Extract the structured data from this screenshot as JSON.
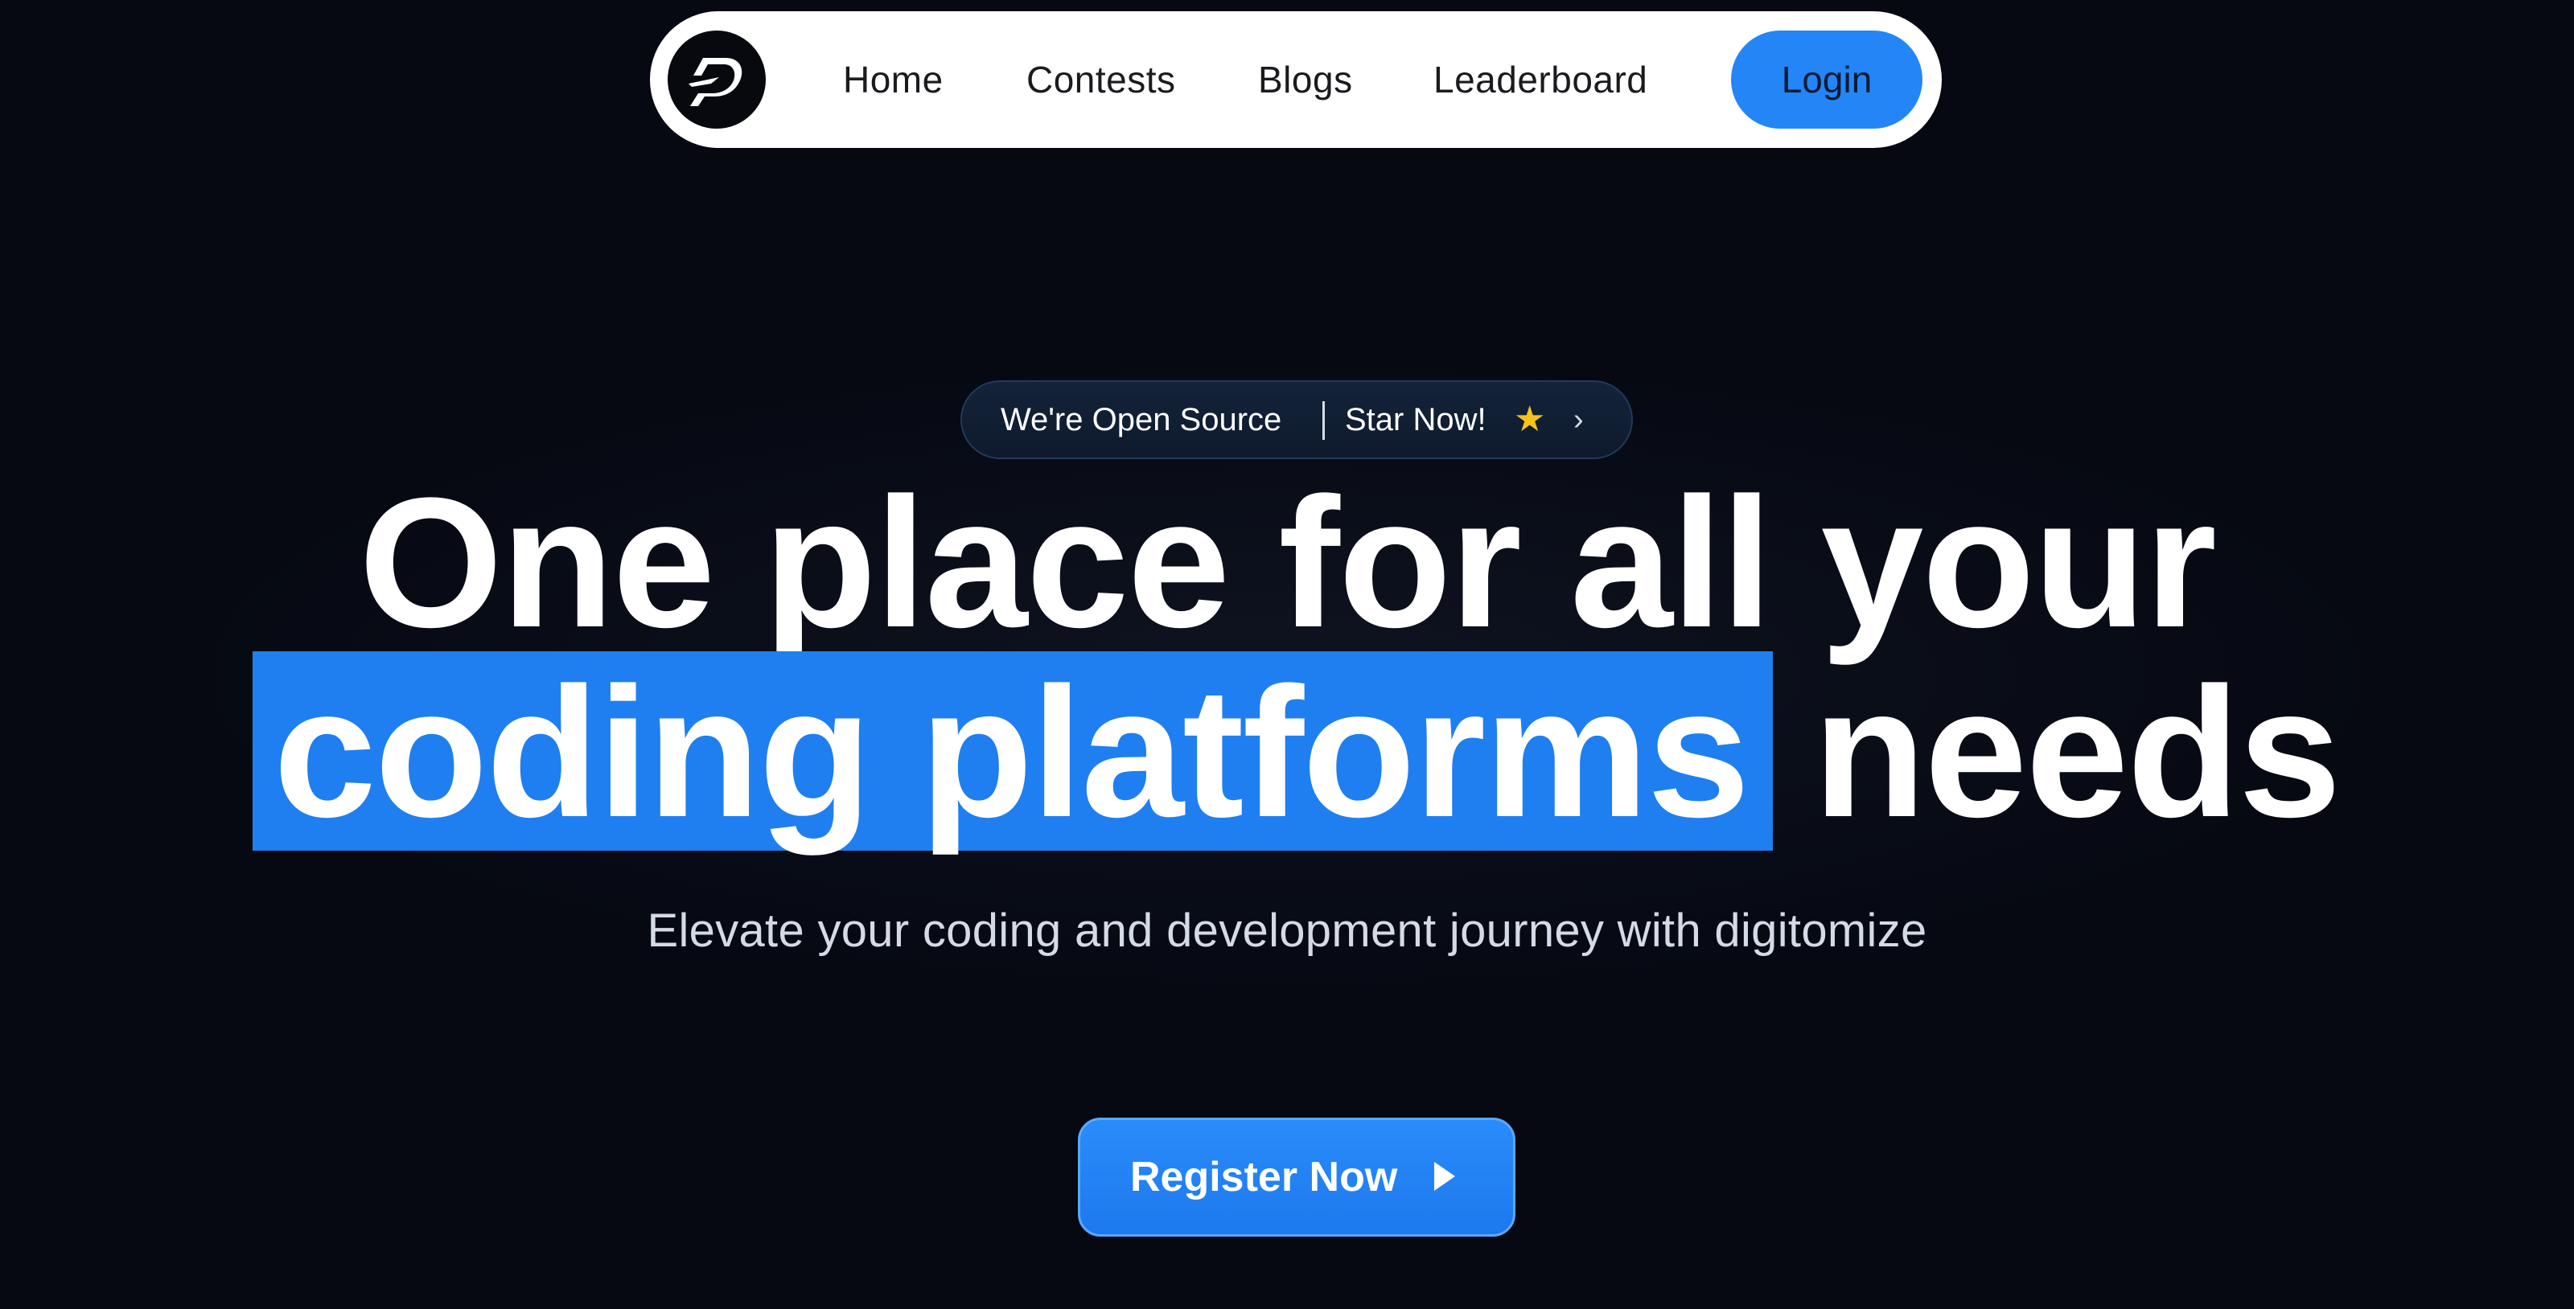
{
  "navbar": {
    "logo_icon": "digitomize-logo-icon",
    "links": [
      {
        "label": "Home"
      },
      {
        "label": "Contests"
      },
      {
        "label": "Blogs"
      },
      {
        "label": "Leaderboard"
      }
    ],
    "login_label": "Login"
  },
  "badge": {
    "left_text": "We're Open Source",
    "right_text": "Star Now!",
    "star_icon": "star-icon",
    "chevron_icon": "chevron-right-icon"
  },
  "hero": {
    "headline_line1": "One place for all your",
    "headline_highlight": "coding platforms",
    "headline_rest": "needs",
    "subheading": "Elevate your coding and development journey with digitomize"
  },
  "cta": {
    "register_label": "Register Now",
    "register_icon": "play-icon"
  },
  "colors": {
    "background": "#060912",
    "accent": "#2486f6",
    "highlight": "#1f7ff0",
    "navbar_bg": "#ffffff"
  }
}
